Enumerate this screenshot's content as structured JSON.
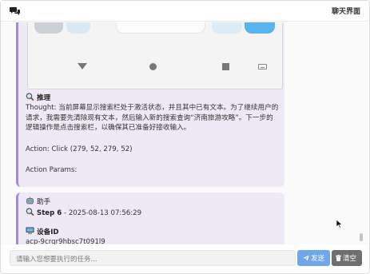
{
  "header": {
    "title": "聊天界面",
    "icon": "chat-bubbles-icon"
  },
  "messages": [
    {
      "section_title": "推理",
      "thought": "Thought: 当前屏幕显示搜索栏处于激活状态，并且其中已有文本。为了继续用户的请求，我需要先清除现有文本，然后输入新的搜索查询“济南旅游攻略”。下一步的逻辑操作是点击搜索栏，以确保其已准备好接收输入。",
      "action": "Action: Click (279, 52, 279, 52)",
      "params": "Action Params:"
    },
    {
      "sender": "助手",
      "step_label": "Step 6",
      "step_time": " - 2025-08-13 07:56:29",
      "device_label": "设备ID",
      "device_id": "acp-9crqr9hbsc7t091l9"
    }
  ],
  "input": {
    "placeholder": "请输入您想要执行的任务..."
  },
  "buttons": {
    "send": "发送",
    "clear": "清空"
  },
  "colors": {
    "bubble_bg": "#efe9f7",
    "bubble_border": "#a48ad0",
    "send_button": "#6ea7ea",
    "clear_button": "#6f6f6f"
  }
}
